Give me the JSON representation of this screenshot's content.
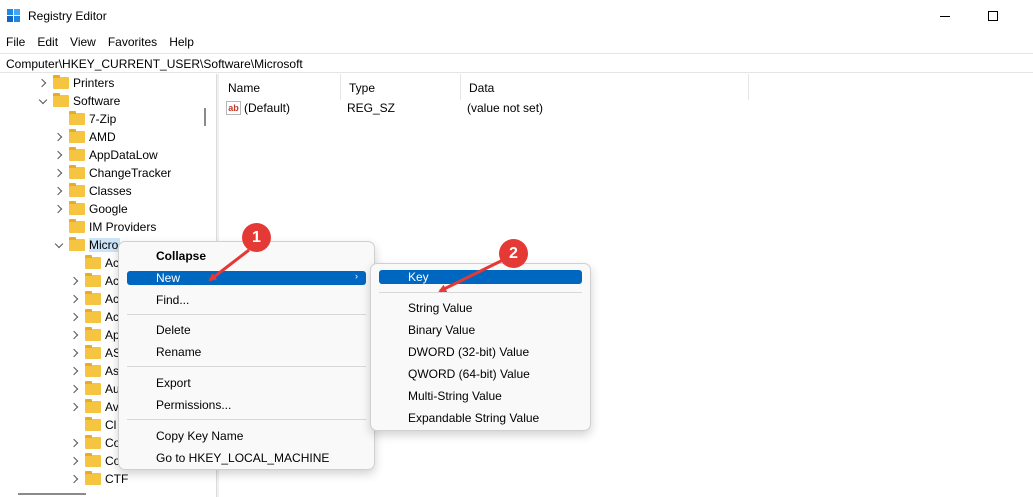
{
  "window": {
    "title": "Registry Editor",
    "min_icon": "minimize-icon",
    "max_icon": "maximize-icon"
  },
  "menu": [
    "File",
    "Edit",
    "View",
    "Favorites",
    "Help"
  ],
  "address": "Computer\\HKEY_CURRENT_USER\\Software\\Microsoft",
  "tree": {
    "items": [
      {
        "label": "Printers",
        "chevron": "right"
      },
      {
        "label": "Software",
        "chevron": "down"
      },
      {
        "label": "7-Zip",
        "chevron": "none"
      },
      {
        "label": "AMD",
        "chevron": "right"
      },
      {
        "label": "AppDataLow",
        "chevron": "right"
      },
      {
        "label": "ChangeTracker",
        "chevron": "right"
      },
      {
        "label": "Classes",
        "chevron": "right"
      },
      {
        "label": "Google",
        "chevron": "right"
      },
      {
        "label": "IM Providers",
        "chevron": "none"
      },
      {
        "label": "Micro",
        "chevron": "down"
      },
      {
        "label": "Ac",
        "chevron": "none"
      },
      {
        "label": "Ac",
        "chevron": "right"
      },
      {
        "label": "Ac",
        "chevron": "right"
      },
      {
        "label": "Ac",
        "chevron": "right"
      },
      {
        "label": "Ap",
        "chevron": "right"
      },
      {
        "label": "AS",
        "chevron": "right"
      },
      {
        "label": "As",
        "chevron": "right"
      },
      {
        "label": "Au",
        "chevron": "right"
      },
      {
        "label": "Av",
        "chevron": "right"
      },
      {
        "label": "Cl",
        "chevron": "none"
      },
      {
        "label": "Co",
        "chevron": "right"
      },
      {
        "label": "Co",
        "chevron": "right"
      },
      {
        "label": "CTF",
        "chevron": "right"
      }
    ]
  },
  "list": {
    "headers": [
      "Name",
      "Type",
      "Data"
    ],
    "rows": [
      {
        "name": "(Default)",
        "type": "REG_SZ",
        "data": "(value not set)",
        "icon": "string-value-icon"
      }
    ]
  },
  "context_menu": {
    "items": [
      "Collapse",
      "New",
      "Find...",
      "Delete",
      "Rename",
      "Export",
      "Permissions...",
      "Copy Key Name",
      "Go to HKEY_LOCAL_MACHINE"
    ]
  },
  "submenu": {
    "items": [
      "Key",
      "String Value",
      "Binary Value",
      "DWORD (32-bit) Value",
      "QWORD (64-bit) Value",
      "Multi-String Value",
      "Expandable String Value"
    ]
  },
  "annotations": {
    "step1": "1",
    "step2": "2",
    "color": "#e53935"
  },
  "colors": {
    "highlight": "#0067c0",
    "selection": "#cce4f7",
    "folder": "#f5c440"
  }
}
